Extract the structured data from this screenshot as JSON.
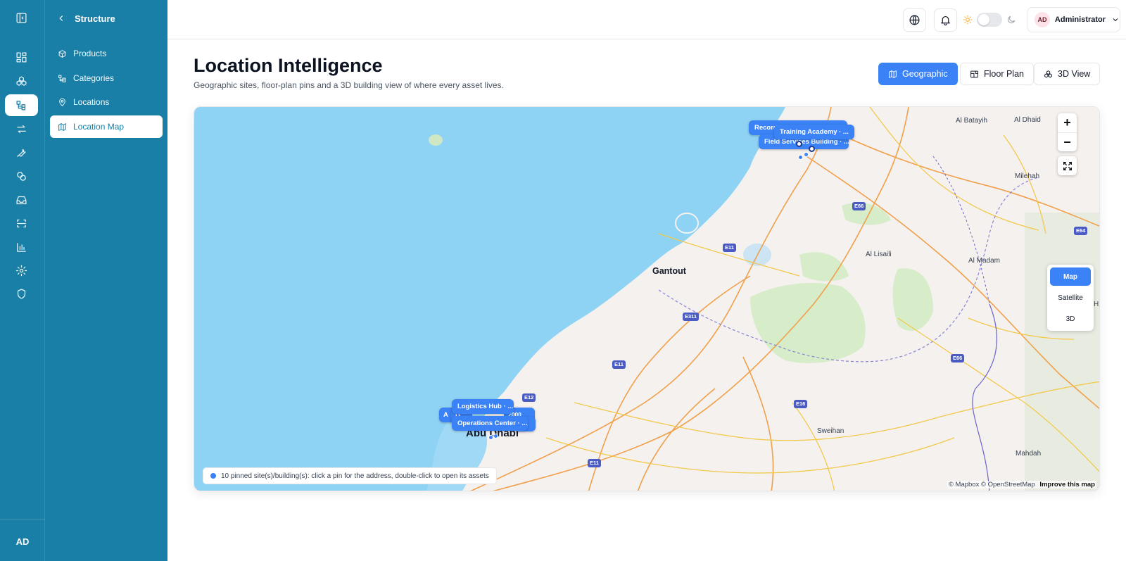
{
  "rail": {
    "initials": "AD",
    "icons": [
      "sidebar-toggle-icon",
      "dashboard-icon",
      "modules-icon",
      "structure-icon",
      "transfers-icon",
      "maintenance-icon",
      "tags-icon",
      "inbox-icon",
      "scan-icon",
      "reports-icon",
      "settings-icon",
      "security-icon"
    ]
  },
  "sidebar": {
    "header": "Structure",
    "items": [
      {
        "label": "Products",
        "icon": "box-icon"
      },
      {
        "label": "Categories",
        "icon": "hierarchy-icon"
      },
      {
        "label": "Locations",
        "icon": "map-pin-icon"
      },
      {
        "label": "Location Map",
        "icon": "map-icon",
        "active": true
      }
    ]
  },
  "topbar": {
    "user_initials": "AD",
    "user_name": "Administrator"
  },
  "page": {
    "title": "Location Intelligence",
    "subtitle": "Geographic sites, floor-plan pins and a 3D building view of where every asset lives.",
    "views": [
      {
        "label": "Geographic",
        "active": true
      },
      {
        "label": "Floor Plan",
        "active": false
      },
      {
        "label": "3D View",
        "active": false
      }
    ]
  },
  "map": {
    "places": {
      "al_batayih": "Al Batayih",
      "al_dhaid": "Al Dhaid",
      "milehah": "Milehah",
      "al_lisaili": "Al Lisaili",
      "al_madam": "Al Madam",
      "gantout": "Gantout",
      "abu_dhabi": "Abu Dhabi",
      "sweihan": "Sweihan",
      "mahdah": "Mahdah",
      "h": "H"
    },
    "highways": [
      "E66",
      "E64",
      "E11",
      "E311",
      "E11",
      "E12",
      "E16",
      "E66",
      "E11"
    ],
    "pins": [
      {
        "label": "Record",
        "area": "north"
      },
      {
        "label": "Training Academy · ...",
        "area": "north"
      },
      {
        "label": "Field Services Building · ...",
        "area": "north"
      },
      {
        "label": "Logistics Hub · ...",
        "area": "south"
      },
      {
        "label": "A",
        "area": "south"
      },
      {
        "label": "H",
        "area": "south"
      },
      {
        "label": "2000",
        "area": "south"
      },
      {
        "label": "00",
        "area": "south"
      },
      {
        "label": "Operations Center · ...",
        "area": "south"
      }
    ],
    "style_options": [
      {
        "label": "Map",
        "active": true
      },
      {
        "label": "Satellite",
        "active": false
      },
      {
        "label": "3D",
        "active": false
      }
    ],
    "status": "10 pinned site(s)/building(s): click a pin for the address, double-click to open its assets",
    "attribution": "© Mapbox © OpenStreetMap",
    "improve": "Improve this map",
    "zoom_in": "+",
    "zoom_out": "−"
  },
  "colors": {
    "brand": "#1a7fa6",
    "accent": "#3b82f6",
    "water": "#8fd3f4",
    "land": "#f5f1ee",
    "park": "#d7ecc8"
  }
}
